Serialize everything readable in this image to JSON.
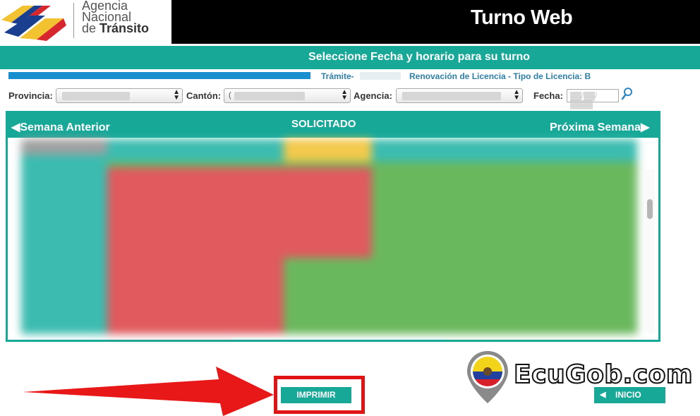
{
  "header": {
    "org_line1": "Agencia",
    "org_line2": "Nacional",
    "org_line3_prefix": "de ",
    "org_line3_bold": "Tránsito",
    "app_title": "Turno Web"
  },
  "subheader": {
    "title": "Seleccione Fecha y horario para su turno",
    "tramite_label": "Trámite-",
    "tramite_desc": "Renovación de Licencia - Tipo de Licencia: B"
  },
  "filters": {
    "provincia_label": "Provincia:",
    "canton_label": "Cantón:",
    "canton_visible_char": "(",
    "agencia_label": "Agencia:",
    "fecha_label": "Fecha:",
    "search_icon": "magnifier-icon"
  },
  "calendar": {
    "prev_label": "Semana Anterior",
    "next_label": "Próxima Semana",
    "status_label": "SOLICITADO",
    "colors": {
      "header": "#17a898",
      "teal_col": "#3cbcb0",
      "red": "#e05a5e",
      "green": "#6ab85e",
      "yellow": "#f2c94c",
      "gray": "#a0a0a0"
    }
  },
  "buttons": {
    "print_label": "IMPRIMIR",
    "home_label": "INICIO"
  },
  "watermark": {
    "text": "EcuGob.com"
  }
}
